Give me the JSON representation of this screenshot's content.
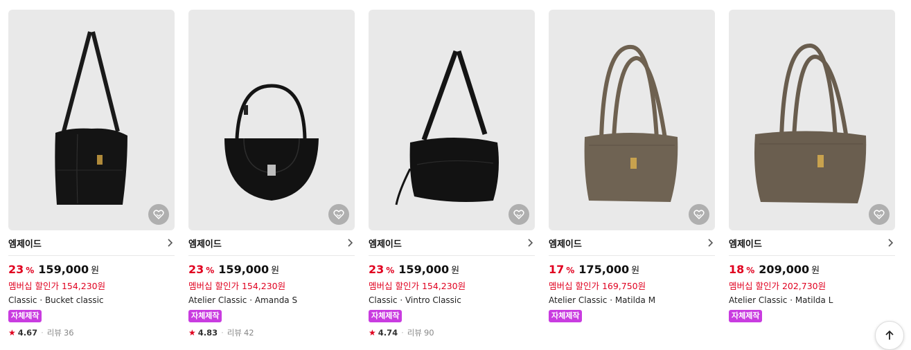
{
  "products": [
    {
      "brand": "엠제이드",
      "discount": "23",
      "percent": "%",
      "price": "159,000",
      "won": "원",
      "member": "멤버십 할인가 154,230원",
      "name": "Classic · Bucket classic",
      "badge": "자체제작",
      "star": "★",
      "rating": "4.67",
      "review_label": "리뷰",
      "review_count": "36",
      "image": "black-bucket-bag"
    },
    {
      "brand": "엠제이드",
      "discount": "23",
      "percent": "%",
      "price": "159,000",
      "won": "원",
      "member": "멤버십 할인가 154,230원",
      "name": "Atelier Classic · Amanda S",
      "badge": "자체제작",
      "star": "★",
      "rating": "4.83",
      "review_label": "리뷰",
      "review_count": "42",
      "image": "black-half-moon-bag"
    },
    {
      "brand": "엠제이드",
      "discount": "23",
      "percent": "%",
      "price": "159,000",
      "won": "원",
      "member": "멤버십 할인가 154,230원",
      "name": "Classic · Vintro Classic",
      "badge": "자체제작",
      "star": "★",
      "rating": "4.74",
      "review_label": "리뷰",
      "review_count": "90",
      "image": "black-slouch-bag"
    },
    {
      "brand": "엠제이드",
      "discount": "17",
      "percent": "%",
      "price": "175,000",
      "won": "원",
      "member": "멤버십 할인가 169,750원",
      "name": "Atelier Classic · Matilda M",
      "badge": "자체제작",
      "image": "taupe-tote-bag"
    },
    {
      "brand": "엠제이드",
      "discount": "18",
      "percent": "%",
      "price": "209,000",
      "won": "원",
      "member": "멤버십 할인가 202,730원",
      "name": "Atelier Classic · Matilda L",
      "badge": "자체제작",
      "image": "taupe-tote-bag-large"
    }
  ],
  "icons": {
    "wishlist": "heart-icon",
    "brand_link": "chevron-right-icon",
    "scroll_top": "arrow-up-icon"
  },
  "colors": {
    "discount": "#e0001f",
    "badge": "#c93ce0",
    "thumb_bg": "#e9e9e9"
  }
}
